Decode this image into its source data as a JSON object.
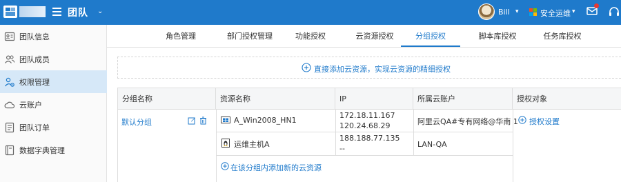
{
  "header": {
    "team_title": "团队",
    "user_name": "Bill",
    "ops_label": "安全运维"
  },
  "sidebar": {
    "items": [
      {
        "label": "团队信息"
      },
      {
        "label": "团队成员"
      },
      {
        "label": "权限管理"
      },
      {
        "label": "云账户"
      },
      {
        "label": "团队订单"
      },
      {
        "label": "数据字典管理"
      }
    ]
  },
  "tabs": [
    {
      "label": "角色管理"
    },
    {
      "label": "部门授权管理"
    },
    {
      "label": "功能授权"
    },
    {
      "label": "云资源授权"
    },
    {
      "label": "分组授权"
    },
    {
      "label": "脚本库授权"
    },
    {
      "label": "任务库授权"
    }
  ],
  "active_tab": "分组授权",
  "add_banner": {
    "label": "直接添加云资源，实现云资源的精细授权"
  },
  "table": {
    "headers": [
      "分组名称",
      "资源名称",
      "IP",
      "所属云账户",
      "授权对象"
    ],
    "group": {
      "name": "默认分组"
    },
    "resources": [
      {
        "name": "A_Win2008_HN1",
        "os_icon": "windows-icon",
        "ip_primary": "172.18.11.167",
        "ip_secondary": "120.24.68.29",
        "account": "阿里云QA#专有网络@华南 1"
      },
      {
        "name": "运维主机A",
        "os_icon": "linux-icon",
        "ip_primary": "188.188.77.135",
        "ip_secondary": "--",
        "account": "LAN-QA"
      }
    ],
    "add_resource_label": "在该分组内添加新的云资源",
    "auth_setting_label": "授权设置"
  },
  "colors": {
    "primary": "#1f7acb",
    "active_sidebar_bg": "#d6e8f8",
    "header_bg": "#1f7acb"
  }
}
